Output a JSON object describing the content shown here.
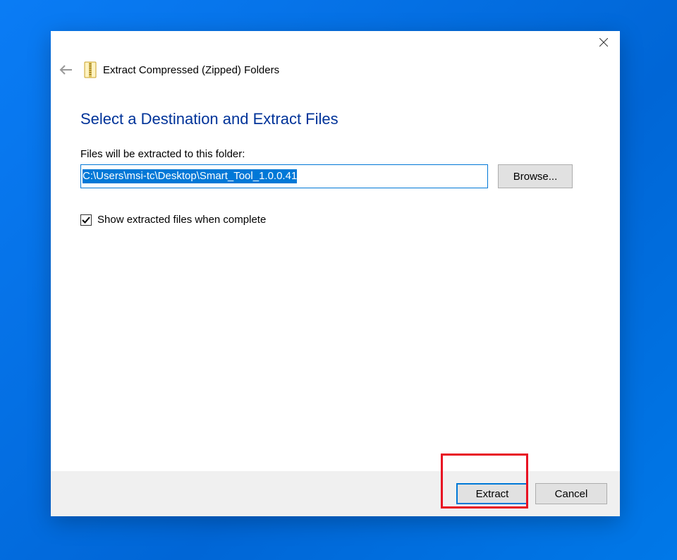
{
  "header": {
    "title": "Extract Compressed (Zipped) Folders"
  },
  "content": {
    "heading": "Select a Destination and Extract Files",
    "pathLabel": "Files will be extracted to this folder:",
    "pathValue": "C:\\Users\\msi-tc\\Desktop\\Smart_Tool_1.0.0.41",
    "browseLabel": "Browse...",
    "checkboxLabel": "Show extracted files when complete",
    "checkboxChecked": true
  },
  "footer": {
    "extractLabel": "Extract",
    "cancelLabel": "Cancel"
  }
}
